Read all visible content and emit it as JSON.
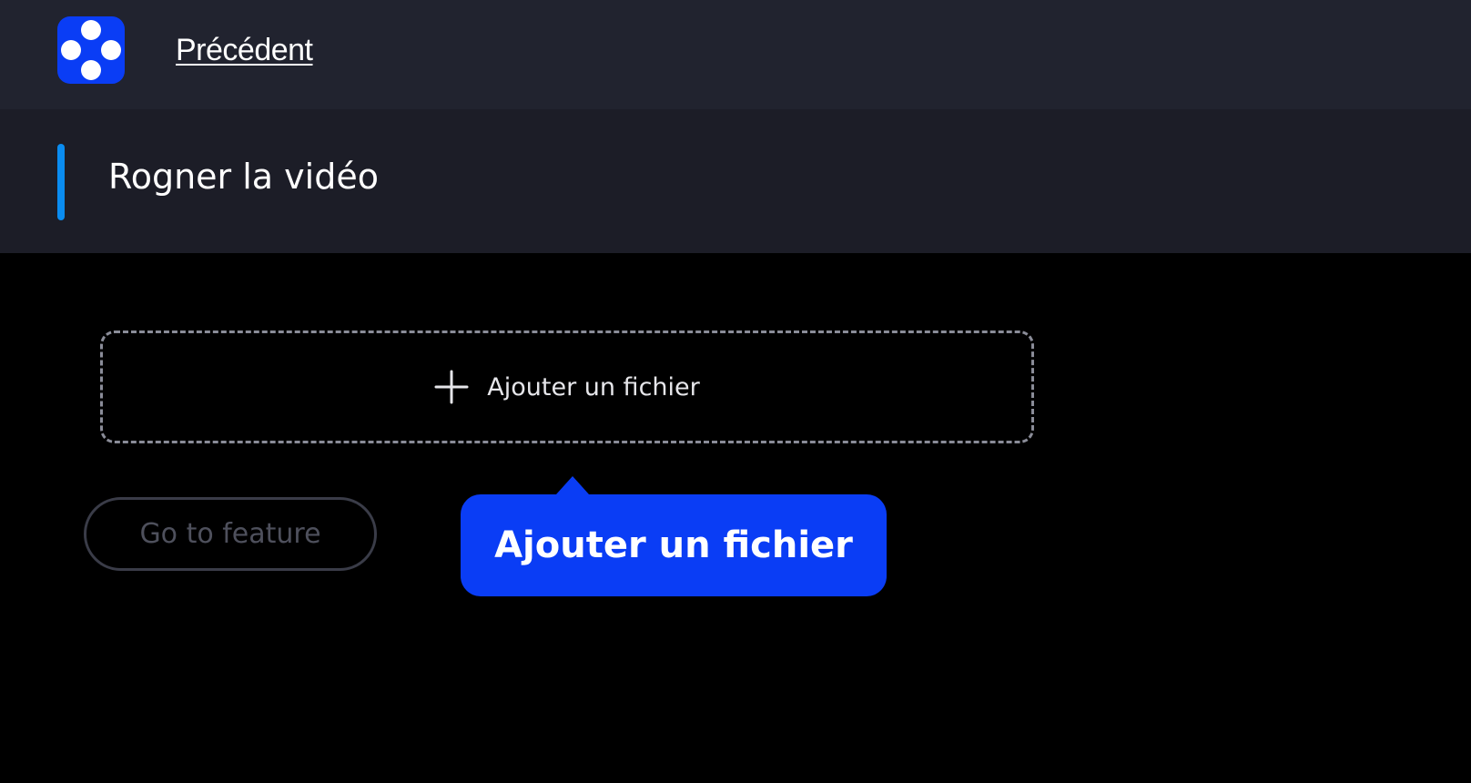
{
  "header": {
    "logo_icon": "app-logo-icon",
    "back_label": "Précédent"
  },
  "title_section": {
    "title": "Rogner la vidéo",
    "accent_color": "#0a8cf0"
  },
  "main": {
    "dropzone": {
      "icon": "plus-icon",
      "label": "Ajouter un fichier"
    },
    "goto_button_label": "Go to feature",
    "tooltip": {
      "text": "Ajouter un fichier",
      "color": "#0a3df5"
    }
  },
  "colors": {
    "topbar": "#21232f",
    "titlebar": "#1c1d27",
    "background": "#000000",
    "brand": "#0a3df5"
  }
}
